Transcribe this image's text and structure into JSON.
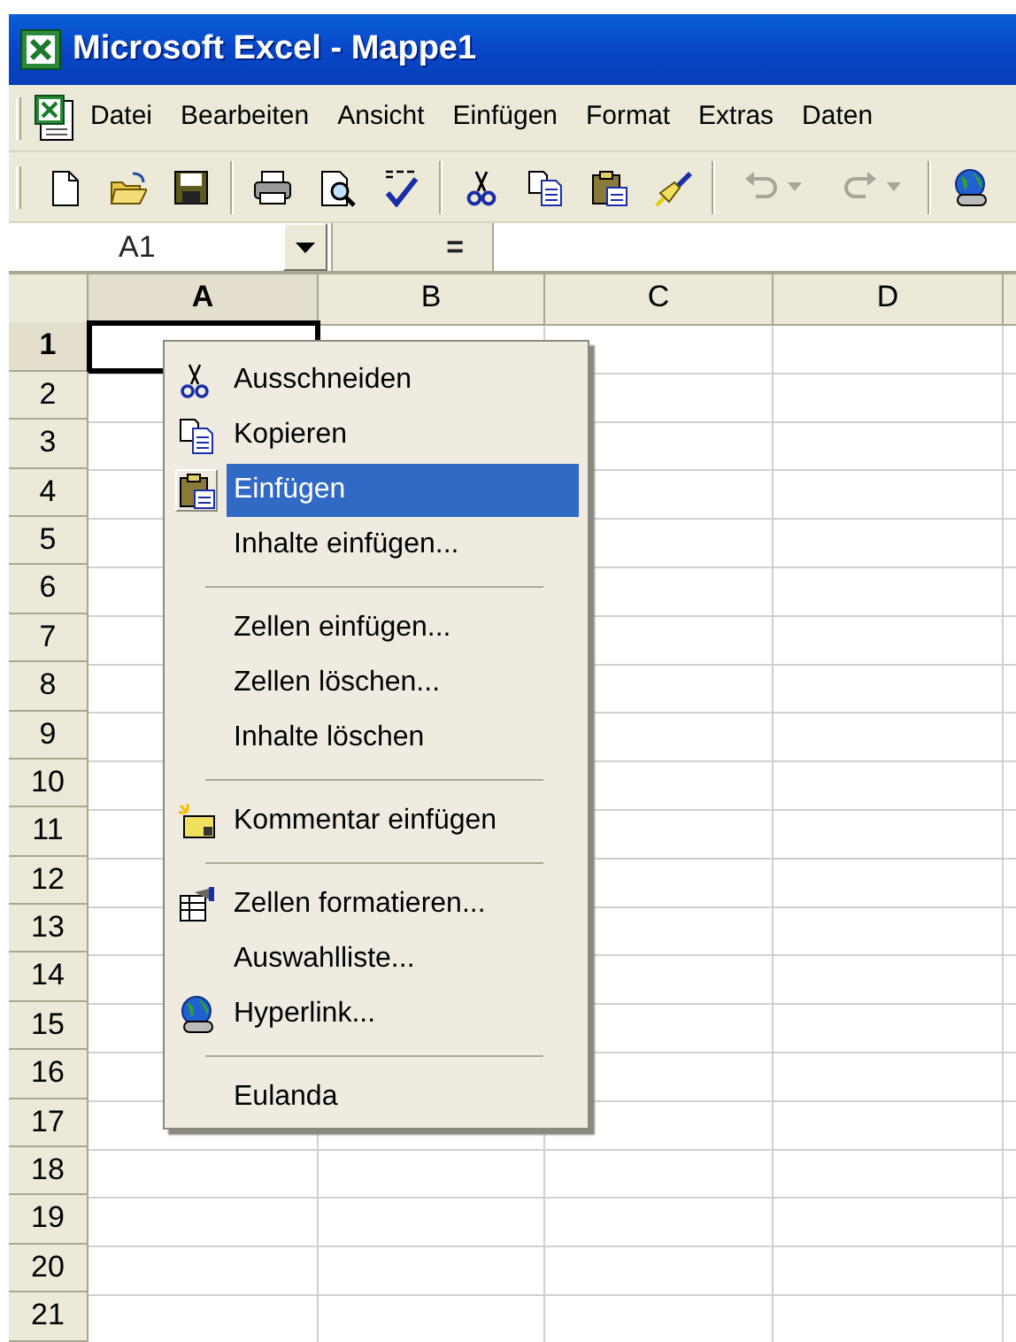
{
  "window": {
    "title": "Microsoft Excel - Mappe1"
  },
  "menu_bar": [
    {
      "label": "Datei"
    },
    {
      "label": "Bearbeiten"
    },
    {
      "label": "Ansicht"
    },
    {
      "label": "Einfügen"
    },
    {
      "label": "Format"
    },
    {
      "label": "Extras"
    },
    {
      "label": "Daten"
    }
  ],
  "toolbar": [
    {
      "kind": "button",
      "disabled": false
    },
    {
      "kind": "button",
      "disabled": false
    },
    {
      "kind": "button",
      "disabled": false
    },
    {
      "kind": "separator"
    },
    {
      "kind": "button",
      "disabled": false
    },
    {
      "kind": "button",
      "disabled": false
    },
    {
      "kind": "button",
      "disabled": false
    },
    {
      "kind": "separator"
    },
    {
      "kind": "button",
      "disabled": false
    },
    {
      "kind": "button",
      "disabled": false
    },
    {
      "kind": "button",
      "disabled": false
    },
    {
      "kind": "button",
      "disabled": false
    },
    {
      "kind": "separator"
    },
    {
      "kind": "split",
      "disabled": true
    },
    {
      "kind": "split",
      "disabled": true
    },
    {
      "kind": "separator"
    },
    {
      "kind": "button",
      "disabled": false
    }
  ],
  "formula_bar": {
    "name_box": "A1",
    "equals": "="
  },
  "columns": [
    {
      "label": "A",
      "selected": true
    },
    {
      "label": "B",
      "selected": false
    },
    {
      "label": "C",
      "selected": false
    },
    {
      "label": "D",
      "selected": false
    }
  ],
  "rows": [
    {
      "label": "1",
      "selected": true
    },
    {
      "label": "2",
      "selected": false
    },
    {
      "label": "3",
      "selected": false
    },
    {
      "label": "4",
      "selected": false
    },
    {
      "label": "5",
      "selected": false
    },
    {
      "label": "6",
      "selected": false
    },
    {
      "label": "7",
      "selected": false
    },
    {
      "label": "8",
      "selected": false
    },
    {
      "label": "9",
      "selected": false
    },
    {
      "label": "10",
      "selected": false
    },
    {
      "label": "11",
      "selected": false
    },
    {
      "label": "12",
      "selected": false
    },
    {
      "label": "13",
      "selected": false
    },
    {
      "label": "14",
      "selected": false
    },
    {
      "label": "15",
      "selected": false
    },
    {
      "label": "16",
      "selected": false
    },
    {
      "label": "17",
      "selected": false
    },
    {
      "label": "18",
      "selected": false
    },
    {
      "label": "19",
      "selected": false
    },
    {
      "label": "20",
      "selected": false
    },
    {
      "label": "21",
      "selected": false
    }
  ],
  "context_menu": [
    {
      "kind": "item",
      "label": "Ausschneiden",
      "selected": false
    },
    {
      "kind": "item",
      "label": "Kopieren",
      "selected": false
    },
    {
      "kind": "item",
      "label": "Einfügen",
      "selected": true
    },
    {
      "kind": "item",
      "label": "Inhalte einfügen...",
      "selected": false
    },
    {
      "kind": "separator"
    },
    {
      "kind": "item",
      "label": "Zellen einfügen...",
      "selected": false
    },
    {
      "kind": "item",
      "label": "Zellen löschen...",
      "selected": false
    },
    {
      "kind": "item",
      "label": "Inhalte löschen",
      "selected": false
    },
    {
      "kind": "separator"
    },
    {
      "kind": "item",
      "label": "Kommentar einfügen",
      "selected": false
    },
    {
      "kind": "separator"
    },
    {
      "kind": "item",
      "label": "Zellen formatieren...",
      "selected": false
    },
    {
      "kind": "item",
      "label": "Auswahlliste...",
      "selected": false
    },
    {
      "kind": "item",
      "label": "Hyperlink...",
      "selected": false
    },
    {
      "kind": "separator"
    },
    {
      "kind": "item",
      "label": "Eulanda",
      "selected": false
    }
  ]
}
